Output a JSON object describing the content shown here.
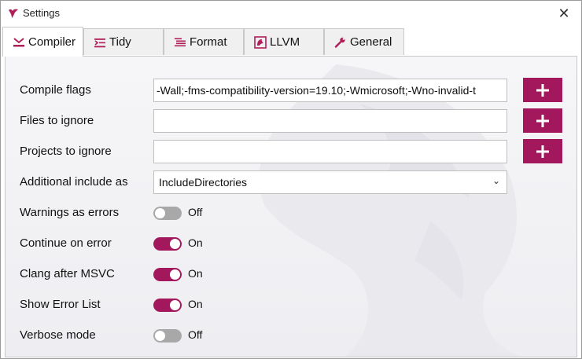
{
  "window": {
    "title": "Settings",
    "close_icon": "close-icon",
    "app_icon": "clang-power-tools-icon"
  },
  "tabs": [
    {
      "label": "Compiler",
      "icon": "compiler-icon",
      "active": true
    },
    {
      "label": "Tidy",
      "icon": "tidy-icon",
      "active": false
    },
    {
      "label": "Format",
      "icon": "format-icon",
      "active": false
    },
    {
      "label": "LLVM",
      "icon": "llvm-icon",
      "active": false
    },
    {
      "label": "General",
      "icon": "wrench-icon",
      "active": false
    }
  ],
  "settings": {
    "compile_flags": {
      "label": "Compile flags",
      "value": "-Wall;-fms-compatibility-version=19.10;-Wmicrosoft;-Wno-invalid-t"
    },
    "files_to_ignore": {
      "label": "Files to ignore",
      "value": ""
    },
    "projects_to_ignore": {
      "label": "Projects to ignore",
      "value": ""
    },
    "additional_include": {
      "label": "Additional include as",
      "value": "IncludeDirectories"
    },
    "warnings_as_errors": {
      "label": "Warnings as errors",
      "state": "Off"
    },
    "continue_on_error": {
      "label": "Continue on error",
      "state": "On"
    },
    "clang_after_msvc": {
      "label": "Clang after MSVC",
      "state": "On"
    },
    "show_error_list": {
      "label": "Show Error List",
      "state": "On"
    },
    "verbose_mode": {
      "label": "Verbose mode",
      "state": "Off"
    }
  },
  "colors": {
    "accent": "#a3185c",
    "toggle_off": "#a8a8a8"
  }
}
